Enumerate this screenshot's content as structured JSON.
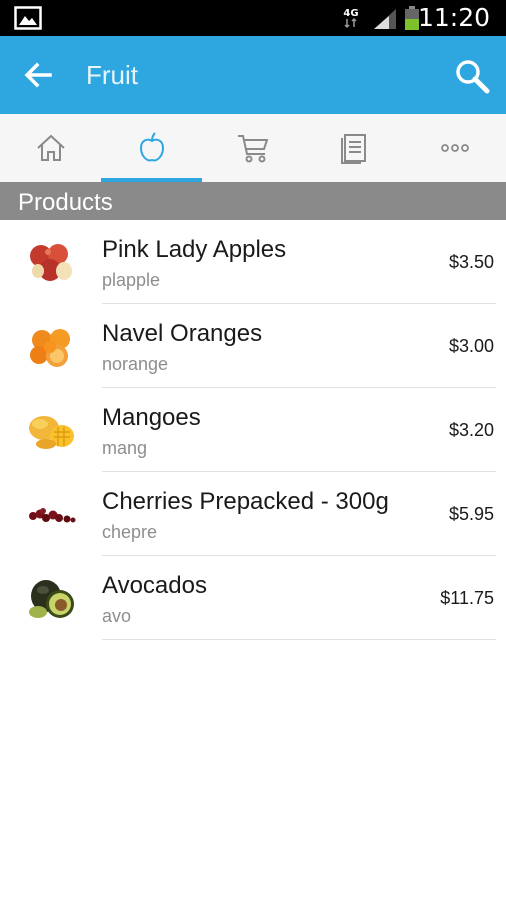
{
  "status_bar": {
    "network": "4G",
    "time": "11:20",
    "icons": [
      "gallery-icon",
      "signal-icon",
      "battery-icon"
    ]
  },
  "app_bar": {
    "title": "Fruit",
    "accent_color": "#2ea6df",
    "icons": [
      "back-arrow-icon",
      "search-icon"
    ]
  },
  "tabs": [
    {
      "icon": "home-icon",
      "active": false
    },
    {
      "icon": "apple-icon",
      "active": true
    },
    {
      "icon": "cart-icon",
      "active": false
    },
    {
      "icon": "document-icon",
      "active": false
    },
    {
      "icon": "more-icon",
      "active": false
    }
  ],
  "section": {
    "title": "Products"
  },
  "products": [
    {
      "name": "Pink Lady Apples",
      "code": "plapple",
      "price": "$3.50",
      "image": "apples"
    },
    {
      "name": "Navel Oranges",
      "code": "norange",
      "price": "$3.00",
      "image": "oranges"
    },
    {
      "name": "Mangoes",
      "code": "mang",
      "price": "$3.20",
      "image": "mangoes"
    },
    {
      "name": "Cherries Prepacked - 300g",
      "code": "chepre",
      "price": "$5.95",
      "image": "cherries"
    },
    {
      "name": "Avocados",
      "code": "avo",
      "price": "$11.75",
      "image": "avocados"
    }
  ]
}
